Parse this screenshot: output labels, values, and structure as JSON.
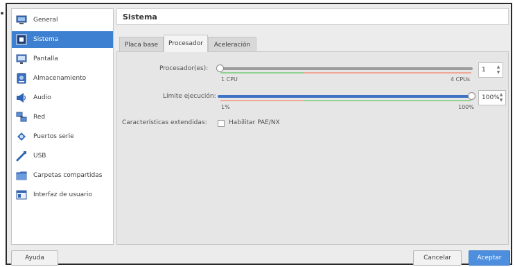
{
  "sidebar": {
    "items": [
      {
        "label": "General",
        "icon": "monitor-icon",
        "selected": false
      },
      {
        "label": "Sistema",
        "icon": "chip-icon",
        "selected": true
      },
      {
        "label": "Pantalla",
        "icon": "display-icon",
        "selected": false
      },
      {
        "label": "Almacenamiento",
        "icon": "storage-icon",
        "selected": false
      },
      {
        "label": "Audio",
        "icon": "speaker-icon",
        "selected": false
      },
      {
        "label": "Red",
        "icon": "network-icon",
        "selected": false
      },
      {
        "label": "Puertos serie",
        "icon": "serial-port-icon",
        "selected": false
      },
      {
        "label": "USB",
        "icon": "usb-icon",
        "selected": false
      },
      {
        "label": "Carpetas compartidas",
        "icon": "shared-folder-icon",
        "selected": false
      },
      {
        "label": "Interfaz de usuario",
        "icon": "user-interface-icon",
        "selected": false
      }
    ]
  },
  "header": {
    "title": "Sistema"
  },
  "tabs": [
    {
      "label": "Placa base",
      "active": false
    },
    {
      "label": "Procesador",
      "active": true
    },
    {
      "label": "Aceleración",
      "active": false
    }
  ],
  "processor": {
    "cpus": {
      "label": "Procesador(es):",
      "value": "1",
      "min_label": "1 CPU",
      "max_label": "4 CPUs",
      "fraction": 0.0
    },
    "execution_cap": {
      "label": "Límite ejecución:",
      "value": "100%",
      "min_label": "1%",
      "max_label": "100%",
      "fraction": 1.0
    },
    "extended_features": {
      "label": "Características extendidas:",
      "checkbox_label": "Habilitar PAE/NX",
      "checked": false
    }
  },
  "buttons": {
    "help": "Ayuda",
    "cancel": "Cancelar",
    "accept": "Aceptar"
  },
  "colors": {
    "selection": "#3d7fd0",
    "slider_fill": "#3f72c4",
    "zone_green": "#8fd18f",
    "zone_red": "#f0a793",
    "accept_button": "#4d8fde"
  }
}
